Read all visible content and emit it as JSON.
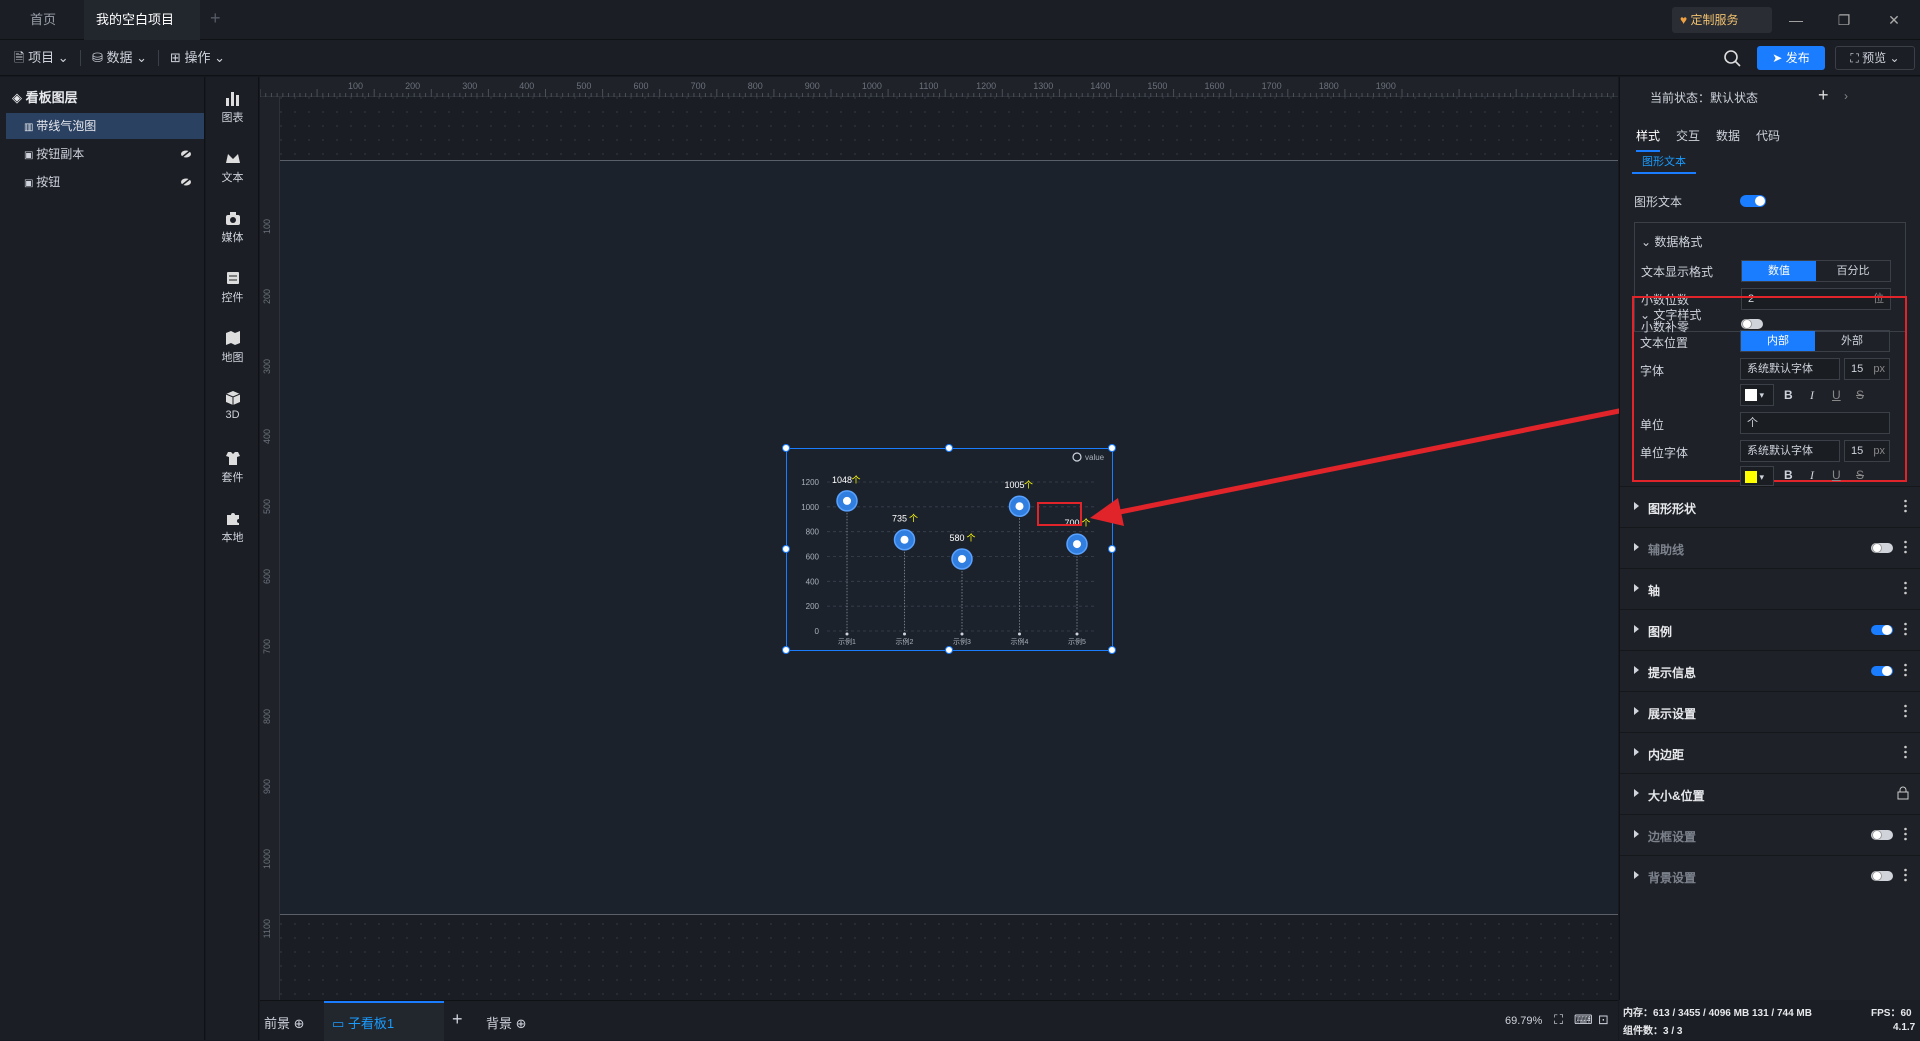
{
  "titlebar": {
    "tabs": [
      {
        "label": "首页"
      },
      {
        "label": "我的空白项目"
      }
    ],
    "custom_service": "定制服务"
  },
  "toolbar": {
    "menus": [
      {
        "label": "项目"
      },
      {
        "label": "数据"
      },
      {
        "label": "操作"
      }
    ],
    "publish": "发布",
    "preview": "预览"
  },
  "layers": {
    "title": "看板图层",
    "items": [
      {
        "label": "带线气泡图"
      },
      {
        "label": "按钮副本"
      },
      {
        "label": "按钮"
      }
    ]
  },
  "rail": {
    "items": [
      {
        "label": "图表",
        "icon": "chart-icon"
      },
      {
        "label": "文本",
        "icon": "text-icon"
      },
      {
        "label": "媒体",
        "icon": "media-icon"
      },
      {
        "label": "控件",
        "icon": "control-icon"
      },
      {
        "label": "地图",
        "icon": "map-icon"
      },
      {
        "label": "3D",
        "icon": "cube-icon"
      },
      {
        "label": "套件",
        "icon": "kit-icon"
      },
      {
        "label": "本地",
        "icon": "puzzle-icon"
      }
    ]
  },
  "rulers": {
    "top": [
      "100",
      "200",
      "300",
      "400",
      "500",
      "600",
      "700",
      "800",
      "900",
      "1000",
      "1100",
      "1200",
      "1300",
      "1400",
      "1500",
      "1600",
      "1700",
      "1800",
      "1900"
    ],
    "left": [
      "100",
      "200",
      "300",
      "400",
      "500",
      "600",
      "700",
      "800",
      "900",
      "1000",
      "1100"
    ]
  },
  "chart_data": {
    "type": "scatter",
    "categories": [
      "示例1",
      "示例2",
      "示例3",
      "示例4",
      "示例5"
    ],
    "values": [
      1048,
      735,
      580,
      1005,
      700
    ],
    "value_labels": [
      "1048",
      "735",
      "580",
      "1005",
      "700"
    ],
    "unit": "个",
    "yticks": [
      "0",
      "200",
      "400",
      "600",
      "800",
      "1000",
      "1200"
    ],
    "ylim": [
      0,
      1200
    ],
    "legend": "value",
    "legend_position": "top-right",
    "grid": true,
    "label_color": "#ffffff",
    "unit_color": "#ffff00",
    "bubble_color": "#2f7ee0"
  },
  "bottombar": {
    "front": "前景",
    "board": "子看板1",
    "back": "背景",
    "zoom": "69.79%"
  },
  "rpanel": {
    "state_label": "当前状态：",
    "state_value": "默认状态",
    "tabs": [
      {
        "label": "样式"
      },
      {
        "label": "交互"
      },
      {
        "label": "数据"
      },
      {
        "label": "代码"
      }
    ],
    "subtab": "图形文本",
    "graphic_text_label": "图形文本",
    "data_format": {
      "title": "数据格式",
      "display_label": "文本显示格式",
      "display_options": [
        "数值",
        "百分比"
      ],
      "decimals_label": "小数位数",
      "decimals_value": "2",
      "decimals_unit": "位",
      "pad_zero_label": "小数补零"
    },
    "text_style": {
      "title": "文字样式",
      "position_label": "文本位置",
      "position_options": [
        "内部",
        "外部"
      ],
      "font_label": "字体",
      "font_value": "系统默认字体",
      "font_size": "15",
      "font_unit": "px",
      "font_color": "#ffffff",
      "unit_label": "单位",
      "unit_value": "个",
      "unit_font_label": "单位字体",
      "unit_font_value": "系统默认字体",
      "unit_font_size": "15",
      "unit_font_unit": "px",
      "unit_font_color": "#ffff00"
    },
    "sections": [
      {
        "label": "图形形状"
      },
      {
        "label": "辅助线"
      },
      {
        "label": "轴"
      },
      {
        "label": "图例"
      },
      {
        "label": "提示信息"
      },
      {
        "label": "展示设置"
      },
      {
        "label": "内边距"
      },
      {
        "label": "大小&位置"
      },
      {
        "label": "边框设置"
      },
      {
        "label": "背景设置"
      }
    ]
  },
  "status": {
    "memory": "内存：613 / 3455 / 4096 MB  131 / 744 MB",
    "fps": "FPS：60",
    "components": "组件数：3 / 3",
    "version": "4.1.7"
  }
}
